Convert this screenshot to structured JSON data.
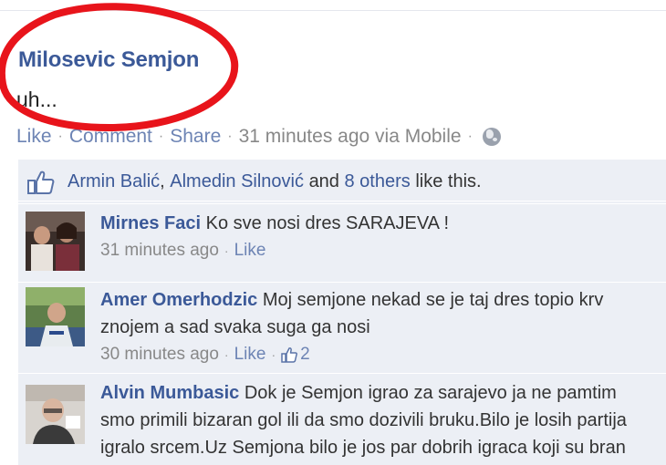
{
  "post": {
    "author": "Milosevic Semjon",
    "text": "uh...",
    "actions": {
      "like": "Like",
      "comment": "Comment",
      "share": "Share",
      "time": "31 minutes ago via Mobile"
    }
  },
  "likes": {
    "name1": "Armin Balić",
    "separator": ",",
    "name2": "Almedin Silnović",
    "and": "and",
    "others": "8 others",
    "suffix": "like this."
  },
  "comments": [
    {
      "name": "Mirnes Faci",
      "text": "Ko sve nosi dres SARAJEVA !",
      "time": "31 minutes ago",
      "like": "Like"
    },
    {
      "name": "Amer Omerhodzic",
      "line1": "Moj semjone nekad se je taj dres topio krv",
      "line2": "znojem a sad svaka suga ga nosi",
      "time": "30 minutes ago",
      "like": "Like",
      "like_count": "2"
    },
    {
      "name": "Alvin Mumbasic",
      "line1": "Dok je Semjon igrao za sarajevo ja ne pamtim",
      "line2": "smo primili bizaran gol ili da smo dozivili bruku.Bilo je losih partija",
      "line3": "igralo srcem.Uz Semjona bilo je jos par dobrih igraca koji su bran"
    }
  ],
  "colors": {
    "link_blue": "#3b5998",
    "action_blue": "#6d84b4",
    "ufi_bg": "#eceff5",
    "annotation_red": "#e8141b"
  },
  "icons": [
    "thumbs-up-icon",
    "globe-icon",
    "red-circle-annotation"
  ]
}
